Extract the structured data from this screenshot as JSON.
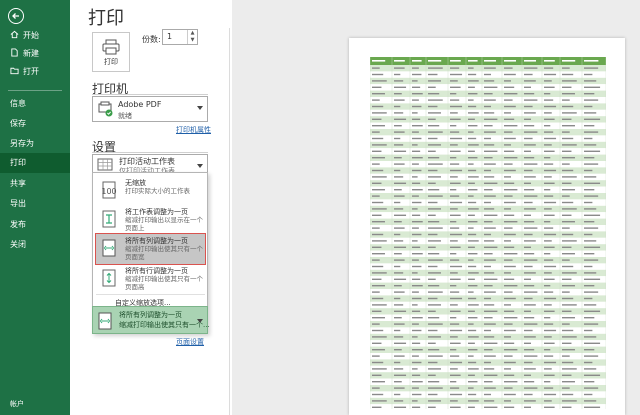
{
  "sidebar": {
    "items": [
      {
        "label": "开始",
        "icon": "home-icon"
      },
      {
        "label": "新建",
        "icon": "new-file-icon"
      },
      {
        "label": "打开",
        "icon": "folder-open-icon"
      },
      {
        "label": "信息"
      },
      {
        "label": "保存"
      },
      {
        "label": "另存为"
      },
      {
        "label": "打印"
      },
      {
        "label": "共享"
      },
      {
        "label": "导出"
      },
      {
        "label": "发布"
      },
      {
        "label": "关闭"
      }
    ],
    "account": "帐户",
    "active_color": "#0f5c2f",
    "bg_color": "#1e7145"
  },
  "print": {
    "title": "打印",
    "button_label": "打印",
    "copies_label": "份数:",
    "copies_value": "1"
  },
  "printer": {
    "heading": "打印机",
    "name": "Adobe PDF",
    "status": "就绪",
    "properties_link": "打印机属性"
  },
  "settings": {
    "heading": "设置",
    "print_what": "打印活动工作表",
    "print_what_sub": "仅打印活动工作表"
  },
  "scale_menu": {
    "options": [
      {
        "title": "无缩放",
        "desc": "打印实际大小的工作表",
        "icon": "no-scaling-icon"
      },
      {
        "title": "将工作表调整为一页",
        "desc": "缩减打印输出以显示在一个页面上",
        "icon": "fit-sheet-icon"
      },
      {
        "title": "将所有列调整为一页",
        "desc": "缩减打印输出使其只有一个页面宽",
        "icon": "fit-columns-icon"
      },
      {
        "title": "将所有行调整为一页",
        "desc": "缩减打印输出使其只有一个页面高",
        "icon": "fit-rows-icon"
      }
    ],
    "selected_index": 2,
    "custom": "自定义缩放选项..."
  },
  "scale_selector": {
    "title": "将所有列调整为一页",
    "desc": "缩减打印输出使其只有一个..."
  },
  "page_setup_link": "页面设置",
  "preview": {
    "header_color": "#6aa84f",
    "stripe_color": "#d9ead3"
  }
}
